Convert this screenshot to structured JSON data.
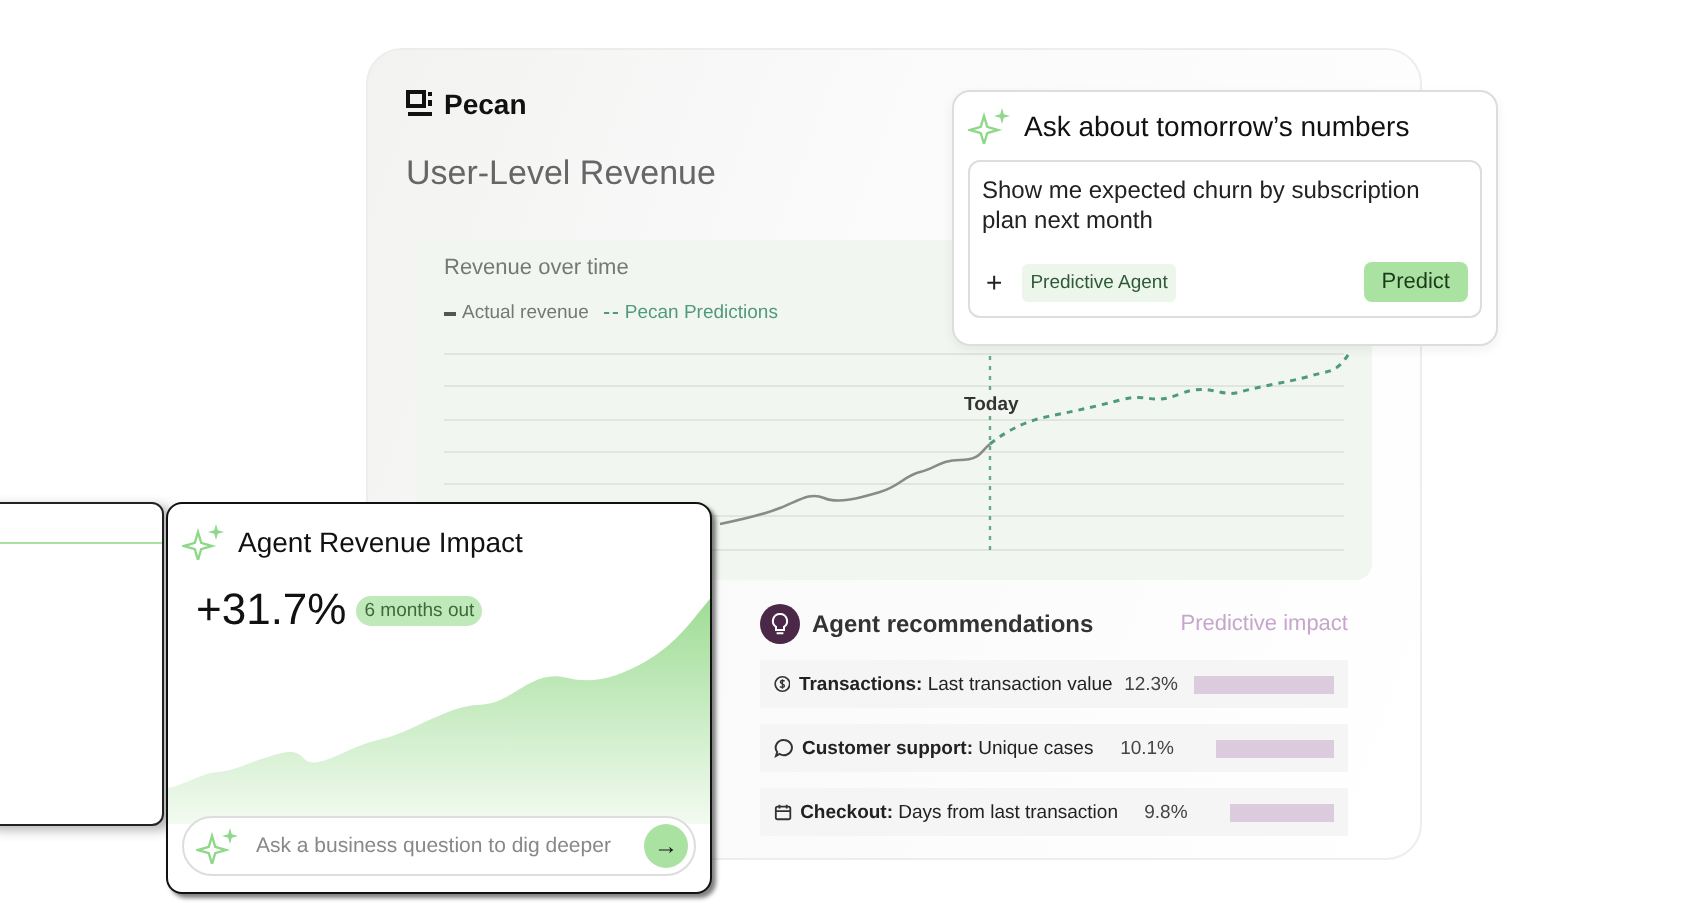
{
  "main_panel": {
    "logo": "Pecan",
    "title": "User-Level Revenue"
  },
  "revenue_chart": {
    "title": "Revenue over time",
    "legend": [
      {
        "label": "Actual revenue",
        "kind": "solid"
      },
      {
        "label": "Pecan Predictions",
        "kind": "dashed"
      }
    ],
    "marker_label": "Today"
  },
  "ask_card": {
    "title": "Ask about tomorrow’s numbers",
    "query": "Show me expected churn by subscription plan next month",
    "add_button": "+",
    "chip": "Predictive Agent",
    "submit_button": "Predict"
  },
  "impact_card": {
    "title": "Agent Revenue Impact",
    "value": "+31.7%",
    "badge": "6 months out",
    "input": {
      "placeholder": "Ask a business question to dig deeper"
    },
    "send_button": "→"
  },
  "recommendations": {
    "title": "Agent recommendations",
    "column_header": "Predictive impact",
    "rows": [
      {
        "kind": "dollar",
        "text": "**Transactions:** Last transaction value",
        "value": "12.3%"
      },
      {
        "kind": "chat",
        "text": "**Customer support:** Unique cases",
        "value": "10.1%"
      },
      {
        "kind": "calendar",
        "text": "**Checkout:** Days from last transaction",
        "value": "9.8%"
      }
    ]
  }
}
